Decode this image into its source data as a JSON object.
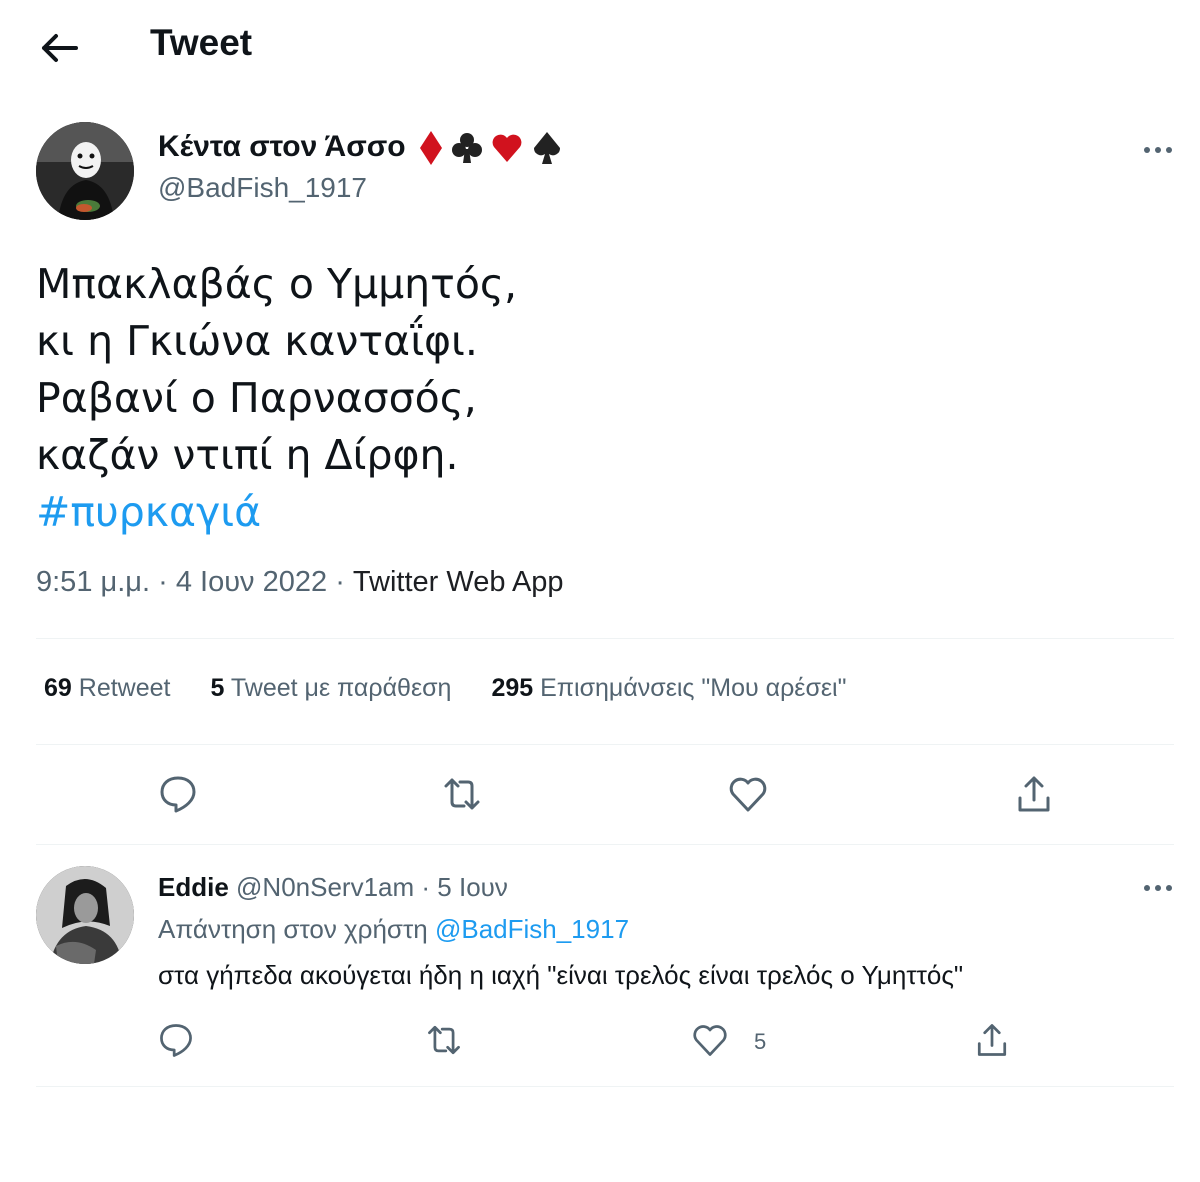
{
  "header": {
    "title": "Tweet"
  },
  "tweet": {
    "author": {
      "display_name": "Κέντα στον Άσσο",
      "handle": "@BadFish_1917",
      "suits": [
        "♦",
        "♣",
        "♥",
        "♠"
      ]
    },
    "lines": [
      "Μπακλαβάς ο Υμμητός,",
      "κι η Γκιώνα κανταΐφι.",
      "Ραβανί ο Παρνασσός,",
      "καζάν ντιπί η Δίρφη."
    ],
    "hashtag": "#πυρκαγιά",
    "meta": {
      "time": "9:51 μ.μ.",
      "date": "4 Ιουν 2022",
      "source": "Twitter Web App",
      "sep": " · "
    },
    "stats": {
      "retweets_count": "69",
      "retweets_label": "Retweet",
      "quotes_count": "5",
      "quotes_label": "Tweet με παράθεση",
      "likes_count": "295",
      "likes_label": "Επισημάνσεις \"Μου αρέσει\""
    }
  },
  "reply": {
    "display_name": "Eddie",
    "handle": "@N0nServ1am",
    "date": "5 Ιουν",
    "sep": " · ",
    "reply_prefix": "Απάντηση στον χρήστη",
    "reply_to": "@BadFish_1917",
    "text": "στα γήπεδα ακούγεται ήδη η ιαχή \"είναι τρελός είναι τρελός ο Υμηττός\"",
    "like_count": "5"
  },
  "icons": {
    "back": "arrow-left-icon",
    "more": "more-horizontal-icon",
    "reply": "reply-icon",
    "retweet": "retweet-icon",
    "like": "heart-icon",
    "share": "share-icon"
  },
  "colors": {
    "accent": "#1d9bf0",
    "diamond": "#d1121e",
    "heart": "#d1121e",
    "club": "#222222",
    "spade": "#222222"
  }
}
